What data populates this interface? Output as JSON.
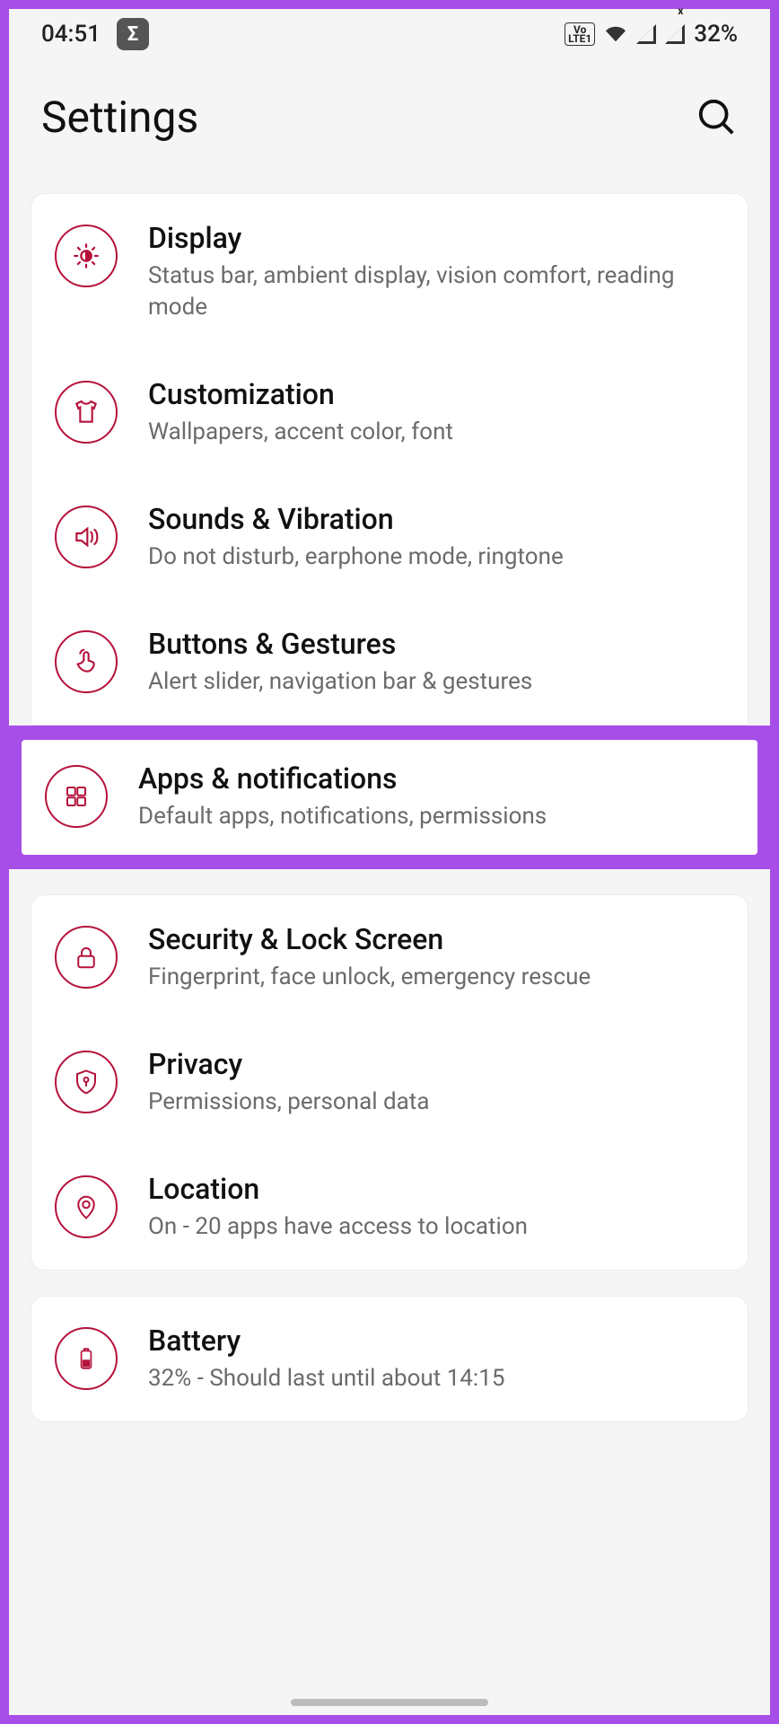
{
  "status": {
    "time": "04:51",
    "sigma": "Σ",
    "volte": "Vo\nLTE1",
    "battery_pct": "32%"
  },
  "header": {
    "title": "Settings"
  },
  "group1": [
    {
      "icon": "brightness-icon",
      "title": "Display",
      "sub": "Status bar, ambient display, vision comfort, reading mode"
    },
    {
      "icon": "tshirt-icon",
      "title": "Customization",
      "sub": "Wallpapers, accent color, font"
    },
    {
      "icon": "speaker-icon",
      "title": "Sounds & Vibration",
      "sub": "Do not disturb, earphone mode, ringtone"
    },
    {
      "icon": "tap-icon",
      "title": "Buttons & Gestures",
      "sub": "Alert slider, navigation bar & gestures"
    }
  ],
  "highlighted": {
    "icon": "apps-icon",
    "title": "Apps & notifications",
    "sub": "Default apps, notifications, permissions"
  },
  "group2": [
    {
      "icon": "lock-icon",
      "title": "Security & Lock Screen",
      "sub": "Fingerprint, face unlock, emergency rescue"
    },
    {
      "icon": "shield-key-icon",
      "title": "Privacy",
      "sub": "Permissions, personal data"
    },
    {
      "icon": "pin-icon",
      "title": "Location",
      "sub": "On - 20 apps have access to location"
    }
  ],
  "group3": [
    {
      "icon": "battery-icon",
      "title": "Battery",
      "sub": "32% - Should last until about 14:15"
    }
  ]
}
